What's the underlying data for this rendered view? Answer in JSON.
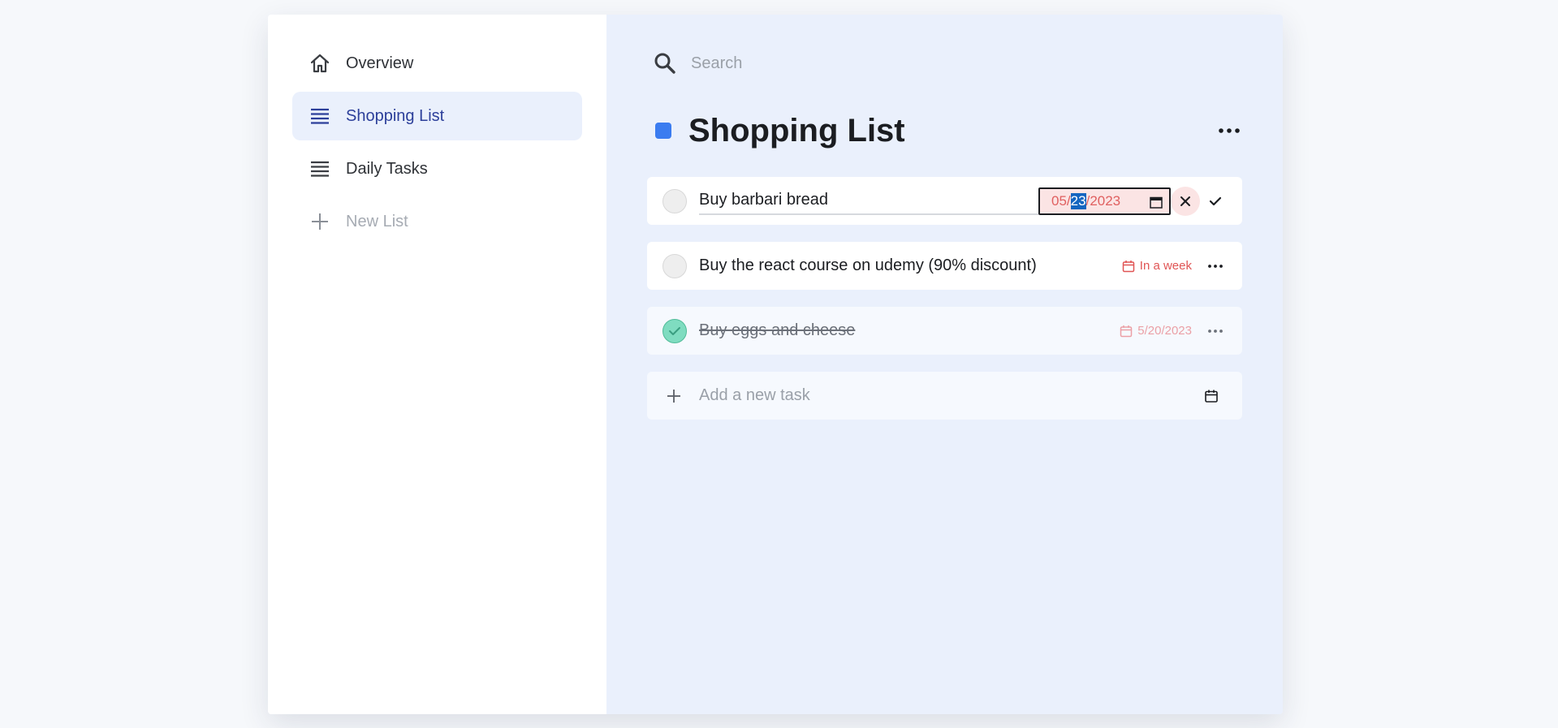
{
  "sidebar": {
    "items": [
      {
        "label": "Overview",
        "icon": "home-icon"
      },
      {
        "label": "Shopping List",
        "icon": "list-icon",
        "active": true
      },
      {
        "label": "Daily Tasks",
        "icon": "list-icon"
      },
      {
        "label": "New List",
        "icon": "plus-icon"
      }
    ]
  },
  "search": {
    "placeholder": "Search"
  },
  "list": {
    "title": "Shopping List",
    "color": "#3b7cf0"
  },
  "tasks": [
    {
      "text": "Buy barbari bread",
      "editing": true,
      "date": {
        "month": "05",
        "day": "23",
        "year": "2023",
        "selected_part": "day"
      }
    },
    {
      "text": "Buy the react course on udemy (90% discount)",
      "due": "In a week",
      "done": false
    },
    {
      "text": "Buy eggs and cheese",
      "due": "5/20/2023",
      "done": true
    }
  ],
  "add_task": {
    "placeholder": "Add a new task"
  },
  "colors": {
    "accent": "#3b7cf0",
    "due": "#e05555",
    "done_check": "#7fdcc0",
    "active_nav": "#2c3f9a"
  }
}
